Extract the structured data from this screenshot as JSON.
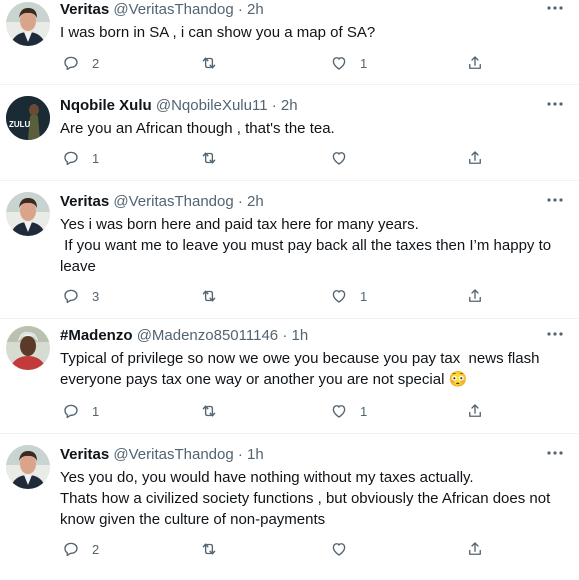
{
  "tweets": [
    {
      "avatar": "veritas",
      "name": "Veritas",
      "handle": "@VeritasThandog",
      "dot": "·",
      "time": "2h",
      "lines": [
        "I was born in SA , i can show you a map of SA?"
      ],
      "replies": "2",
      "retweets": "",
      "likes": "1"
    },
    {
      "avatar": "nqobile",
      "avatar_text": "ZULU",
      "name": "Nqobile Xulu",
      "handle": "@NqobileXulu11",
      "dot": "·",
      "time": "2h",
      "lines": [
        "Are you an African though , that's the tea."
      ],
      "replies": "1",
      "retweets": "",
      "likes": ""
    },
    {
      "avatar": "veritas",
      "name": "Veritas",
      "handle": "@VeritasThandog",
      "dot": "·",
      "time": "2h",
      "lines": [
        "Yes i was born here and paid tax here for many years.",
        " If you want me to leave you must pay back all the taxes then I’m happy to",
        "leave"
      ],
      "replies": "3",
      "retweets": "",
      "likes": "1"
    },
    {
      "avatar": "madenzo",
      "name": "#Madenzo",
      "handle": "@Madenzo85011146",
      "dot": "·",
      "time": "1h",
      "lines": [
        "Typical of privilege so now we owe you because you pay tax  news flash",
        "everyone pays tax one way or another you are not special 😳"
      ],
      "replies": "1",
      "retweets": "",
      "likes": "1"
    },
    {
      "avatar": "veritas",
      "name": "Veritas",
      "handle": "@VeritasThandog",
      "dot": "·",
      "time": "1h",
      "lines": [
        "Yes you do, you would have nothing without my taxes actually.",
        "Thats how a civilized society functions , but obviously the African does not",
        "know given the culture of non-payments"
      ],
      "replies": "2",
      "retweets": "",
      "likes": ""
    }
  ],
  "icons": {
    "reply": "reply-icon",
    "retweet": "retweet-icon",
    "like": "heart-icon",
    "share": "share-icon",
    "more": "more-icon"
  },
  "colors": {
    "text": "#0f1419",
    "secondary": "#536471",
    "divider": "#eff3f4"
  }
}
